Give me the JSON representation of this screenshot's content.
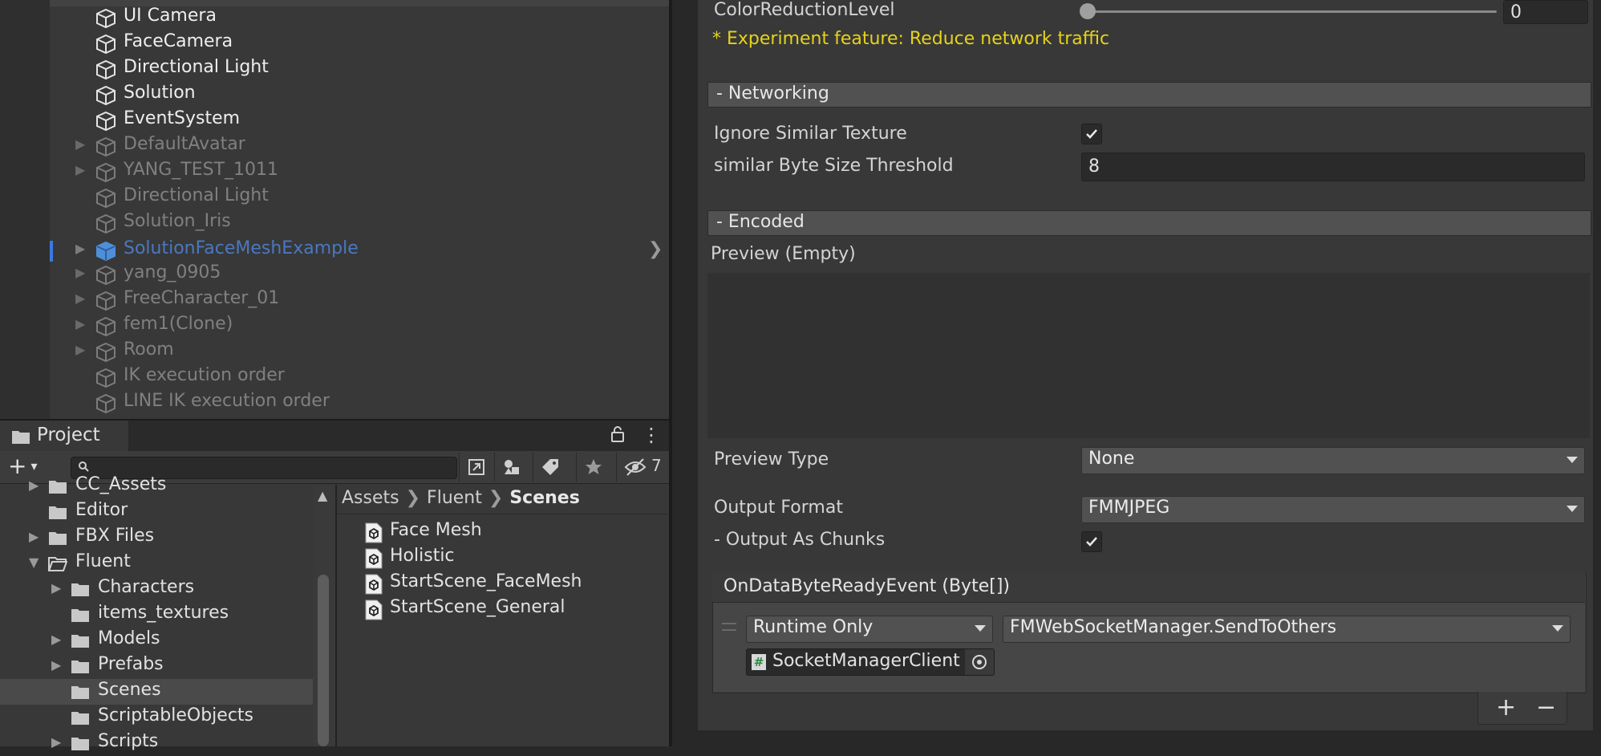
{
  "hierarchy": {
    "items": [
      {
        "label": "UI Camera",
        "state": "active",
        "expandable": false
      },
      {
        "label": "FaceCamera",
        "state": "active",
        "expandable": false
      },
      {
        "label": "Directional Light",
        "state": "active",
        "expandable": false
      },
      {
        "label": "Solution",
        "state": "active",
        "expandable": false
      },
      {
        "label": "EventSystem",
        "state": "active",
        "expandable": false
      },
      {
        "label": "DefaultAvatar",
        "state": "inactive",
        "expandable": true
      },
      {
        "label": "YANG_TEST_1011",
        "state": "inactive",
        "expandable": true
      },
      {
        "label": "Directional Light",
        "state": "inactive",
        "expandable": false
      },
      {
        "label": "Solution_Iris",
        "state": "inactive",
        "expandable": false
      },
      {
        "label": "SolutionFaceMeshExample",
        "state": "selected",
        "expandable": true
      },
      {
        "label": "yang_0905",
        "state": "inactive",
        "expandable": true
      },
      {
        "label": "FreeCharacter_01",
        "state": "inactive",
        "expandable": true
      },
      {
        "label": "fem1(Clone)",
        "state": "inactive",
        "expandable": true
      },
      {
        "label": "Room",
        "state": "inactive",
        "expandable": true
      },
      {
        "label": "IK execution order",
        "state": "inactive",
        "expandable": false
      },
      {
        "label": "LINE IK execution order",
        "state": "inactive",
        "expandable": false
      }
    ]
  },
  "project": {
    "tab_label": "Project",
    "add_label": "+",
    "search": {
      "value": "",
      "placeholder": ""
    },
    "hidden_count": "7",
    "tree": [
      {
        "label": "CC_Assets",
        "expandable": true,
        "open": false,
        "depth": 0
      },
      {
        "label": "Editor",
        "expandable": false,
        "open": false,
        "depth": 0
      },
      {
        "label": "FBX Files",
        "expandable": true,
        "open": false,
        "depth": 0
      },
      {
        "label": "Fluent",
        "expandable": true,
        "open": true,
        "depth": 0
      },
      {
        "label": "Characters",
        "expandable": true,
        "open": false,
        "depth": 1
      },
      {
        "label": "items_textures",
        "expandable": false,
        "open": false,
        "depth": 1
      },
      {
        "label": "Models",
        "expandable": true,
        "open": false,
        "depth": 1
      },
      {
        "label": "Prefabs",
        "expandable": true,
        "open": false,
        "depth": 1
      },
      {
        "label": "Scenes",
        "expandable": false,
        "open": false,
        "depth": 1,
        "selected": true
      },
      {
        "label": "ScriptableObjects",
        "expandable": false,
        "open": false,
        "depth": 1
      },
      {
        "label": "Scripts",
        "expandable": true,
        "open": false,
        "depth": 1
      }
    ],
    "breadcrumb": [
      "Assets",
      "Fluent",
      "Scenes"
    ],
    "assets": [
      "Face Mesh",
      "Holistic",
      "StartScene_FaceMesh",
      "StartScene_General"
    ]
  },
  "inspector": {
    "color_reduction": {
      "label": "ColorReductionLevel",
      "value": "0"
    },
    "experiment_note": "* Experiment feature: Reduce network traffic",
    "networking": {
      "header": "- Networking",
      "ignore_similar_label": "Ignore Similar Texture",
      "ignore_similar_checked": true,
      "threshold_label": "similar Byte Size Threshold",
      "threshold_value": "8"
    },
    "encoded": {
      "header": "- Encoded",
      "preview_label": "Preview (Empty)",
      "preview_type_label": "Preview Type",
      "preview_type_value": "None",
      "output_format_label": "Output Format",
      "output_format_value": "FMMJPEG",
      "chunks_label": "- Output As Chunks",
      "chunks_checked": true
    },
    "event": {
      "header": "OnDataByteReadyEvent (Byte[])",
      "runtime_value": "Runtime Only",
      "function_value": "FMWebSocketManager.SendToOthers",
      "object_value": "SocketManagerClient",
      "add_label": "+",
      "remove_label": "−"
    }
  },
  "colors": {
    "warning_text": "#e6d21a",
    "selection_blue": "#4a78c0"
  }
}
